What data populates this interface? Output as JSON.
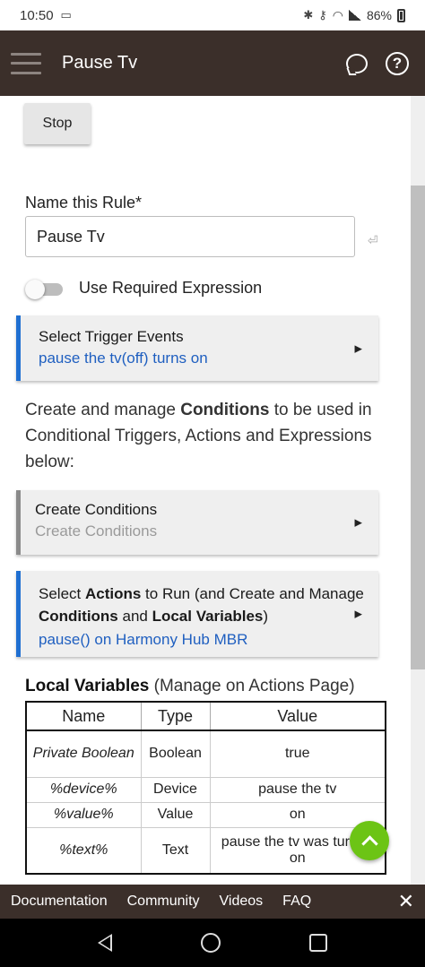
{
  "status_bar": {
    "time": "10:50",
    "battery": "86%"
  },
  "app_bar": {
    "title": "Pause Tv"
  },
  "stop_button": {
    "label": "Stop"
  },
  "rule_name": {
    "label": "Name this Rule*",
    "value": "Pause Tv"
  },
  "required_expression": {
    "label": "Use Required Expression",
    "enabled": false
  },
  "trigger_card": {
    "title": "Select Trigger Events",
    "summary": "pause the tv(off) turns on"
  },
  "conditions_text": {
    "pre": "Create and manage ",
    "bold": "Conditions",
    "post": " to be used in Conditional Triggers, Actions and Expressions below:"
  },
  "conditions_card": {
    "title": "Create Conditions",
    "summary": "Create Conditions"
  },
  "actions_card": {
    "t1": "Select ",
    "b1": "Actions",
    "t2": " to Run (and Create and Manage ",
    "b2": "Conditions",
    "t3": " and ",
    "b3": "Local Variables",
    "t4": ")",
    "summary": "pause() on Harmony Hub MBR"
  },
  "local_variables": {
    "title": "Local Variables",
    "subtitle": " (Manage on Actions Page)",
    "headers": {
      "name": "Name",
      "type": "Type",
      "value": "Value"
    },
    "rows": [
      {
        "name": "Private Boolean",
        "type": "Boolean",
        "value": "true"
      },
      {
        "name": "%device%",
        "type": "Device",
        "value": "pause the tv"
      },
      {
        "name": "%value%",
        "type": "Value",
        "value": "on"
      },
      {
        "name": "%text%",
        "type": "Text",
        "value": "pause the tv was turned on"
      }
    ]
  },
  "footer": {
    "documentation": "Documentation",
    "community": "Community",
    "videos": "Videos",
    "faq": "FAQ"
  },
  "colors": {
    "app_bar": "#3b2f2a",
    "accent_blue": "#1f6fd1",
    "fab_green": "#6cc415"
  }
}
